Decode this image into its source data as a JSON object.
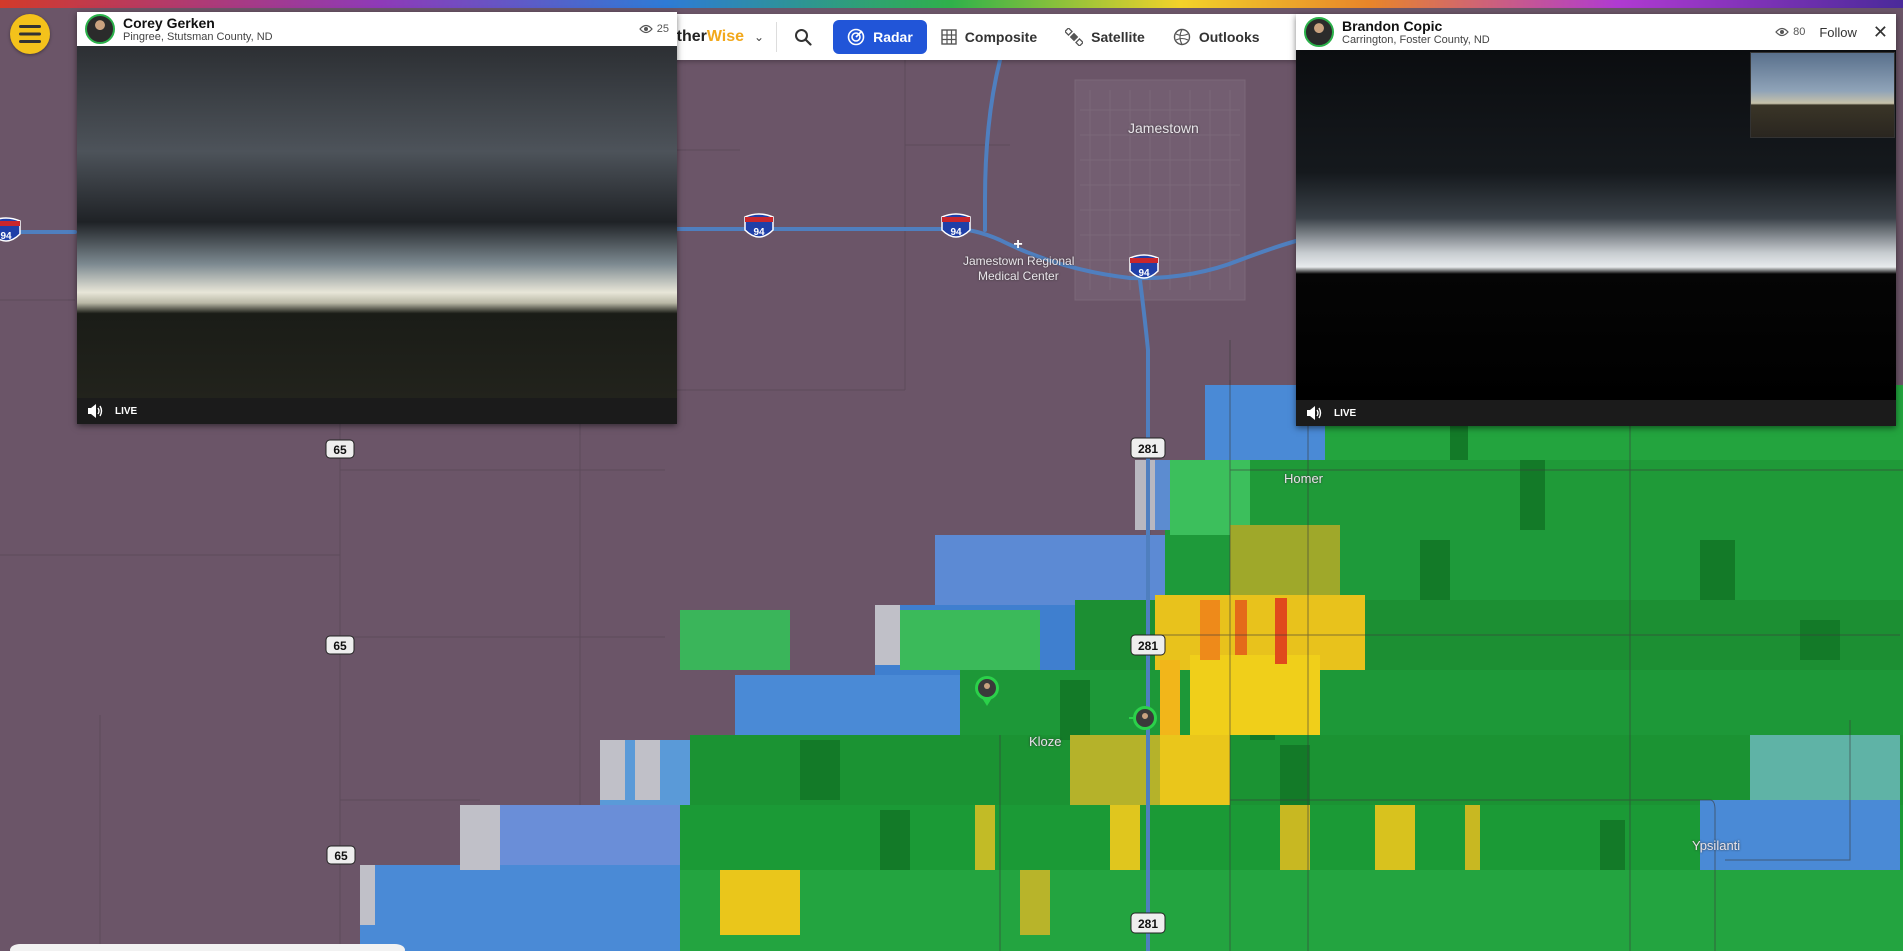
{
  "app": {
    "brand_part1": "Weather",
    "brand_part2": "Wise",
    "accent_color": "#f4c21b",
    "active_color": "#2155d8"
  },
  "toolbar": {
    "tabs": [
      {
        "label": "Radar",
        "icon": "radar-icon",
        "active": true
      },
      {
        "label": "Composite",
        "icon": "grid-icon",
        "active": false
      },
      {
        "label": "Satellite",
        "icon": "satellite-icon",
        "active": false
      },
      {
        "label": "Outlooks",
        "icon": "globe-icon",
        "active": false
      }
    ]
  },
  "streams": [
    {
      "name": "Corey Gerken",
      "location": "Pingree, Stutsman County, ND",
      "viewers": "25",
      "live_label": "LIVE"
    },
    {
      "name": "Brandon Copic",
      "location": "Carrington, Foster County, ND",
      "viewers": "80",
      "follow_label": "Follow",
      "live_label": "LIVE"
    }
  ],
  "map": {
    "places": [
      "Jamestown",
      "Homer",
      "Kloze",
      "Ypsilanti"
    ],
    "poi": [
      "Jamestown Regional",
      "Medical Center"
    ],
    "interstate": "94",
    "us_highway": "281",
    "state_highway": "65"
  }
}
